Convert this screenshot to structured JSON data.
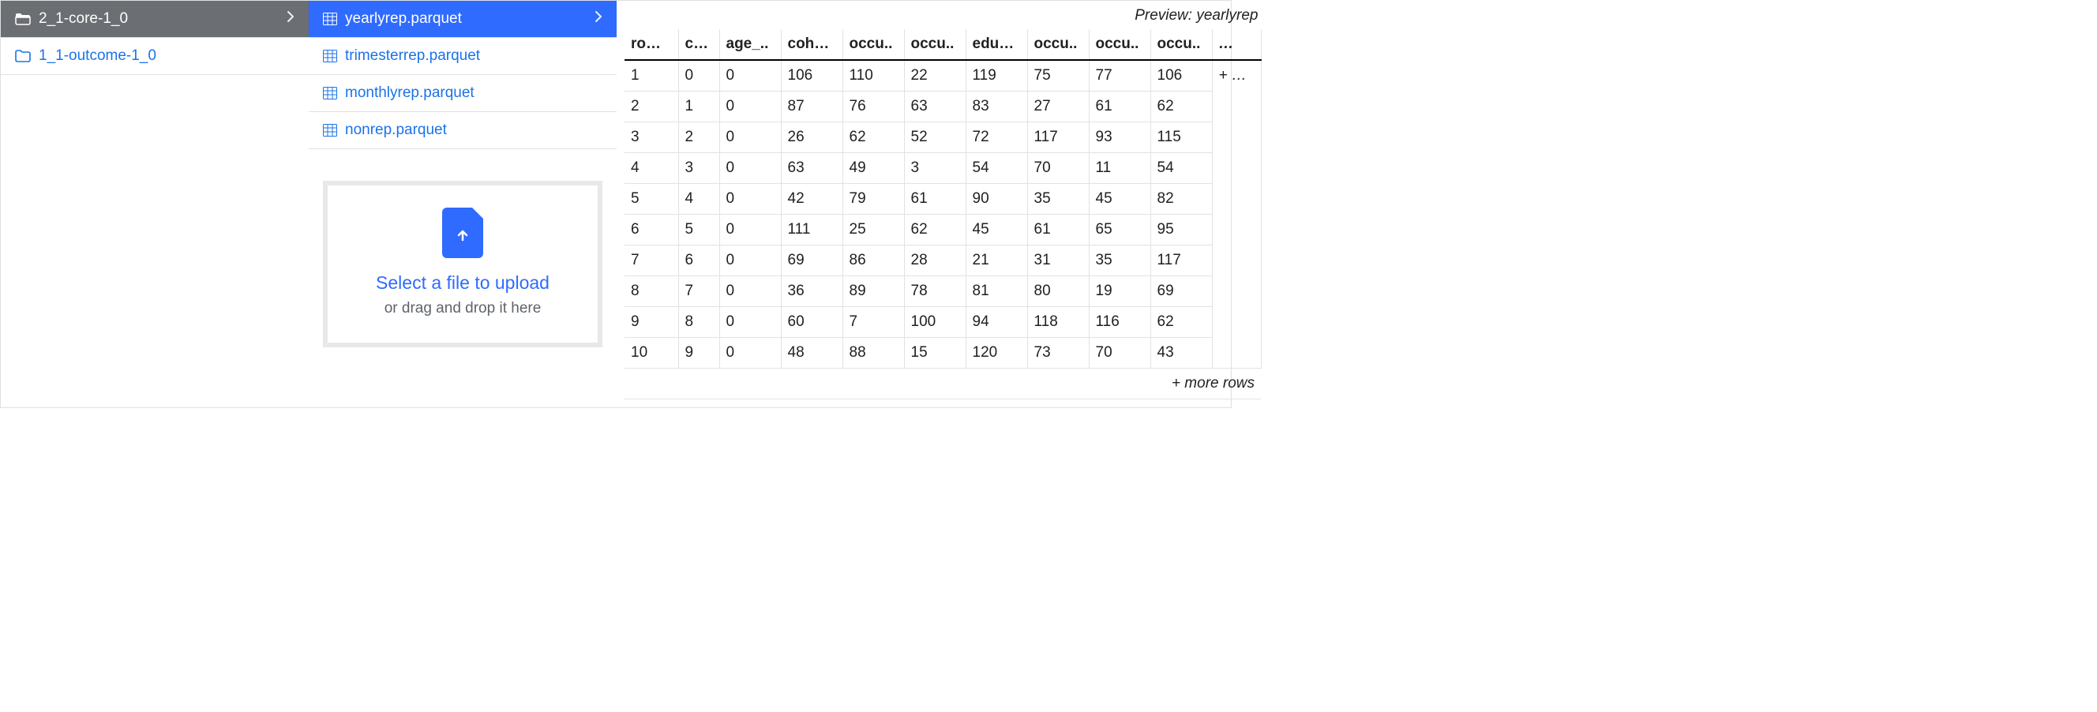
{
  "folders": [
    {
      "name": "2_1-core-1_0",
      "selected": true
    },
    {
      "name": "1_1-outcome-1_0",
      "selected": false
    }
  ],
  "files": [
    {
      "name": "yearlyrep.parquet",
      "selected": true
    },
    {
      "name": "trimesterrep.parquet",
      "selected": false
    },
    {
      "name": "monthlyrep.parquet",
      "selected": false
    },
    {
      "name": "nonrep.parquet",
      "selected": false
    }
  ],
  "upload": {
    "title": "Select a file to upload",
    "subtitle": "or drag and drop it here"
  },
  "preview": {
    "title_prefix": "Preview: ",
    "title_name": "yearlyrep",
    "columns": [
      "row_id",
      "chil..",
      "age_..",
      "cohab_",
      "occu..",
      "occu..",
      "edu_m_",
      "occu..",
      "occu..",
      "occu..",
      "…"
    ],
    "more_text": "+ more",
    "rows": [
      [
        "1",
        "0",
        "0",
        "106",
        "110",
        "22",
        "119",
        "75",
        "77",
        "106"
      ],
      [
        "2",
        "1",
        "0",
        "87",
        "76",
        "63",
        "83",
        "27",
        "61",
        "62"
      ],
      [
        "3",
        "2",
        "0",
        "26",
        "62",
        "52",
        "72",
        "117",
        "93",
        "115"
      ],
      [
        "4",
        "3",
        "0",
        "63",
        "49",
        "3",
        "54",
        "70",
        "11",
        "54"
      ],
      [
        "5",
        "4",
        "0",
        "42",
        "79",
        "61",
        "90",
        "35",
        "45",
        "82"
      ],
      [
        "6",
        "5",
        "0",
        "111",
        "25",
        "62",
        "45",
        "61",
        "65",
        "95"
      ],
      [
        "7",
        "6",
        "0",
        "69",
        "86",
        "28",
        "21",
        "31",
        "35",
        "117"
      ],
      [
        "8",
        "7",
        "0",
        "36",
        "89",
        "78",
        "81",
        "80",
        "19",
        "69"
      ],
      [
        "9",
        "8",
        "0",
        "60",
        "7",
        "100",
        "94",
        "118",
        "116",
        "62"
      ],
      [
        "10",
        "9",
        "0",
        "48",
        "88",
        "15",
        "120",
        "73",
        "70",
        "43"
      ]
    ],
    "more_rows": "+ more rows"
  }
}
